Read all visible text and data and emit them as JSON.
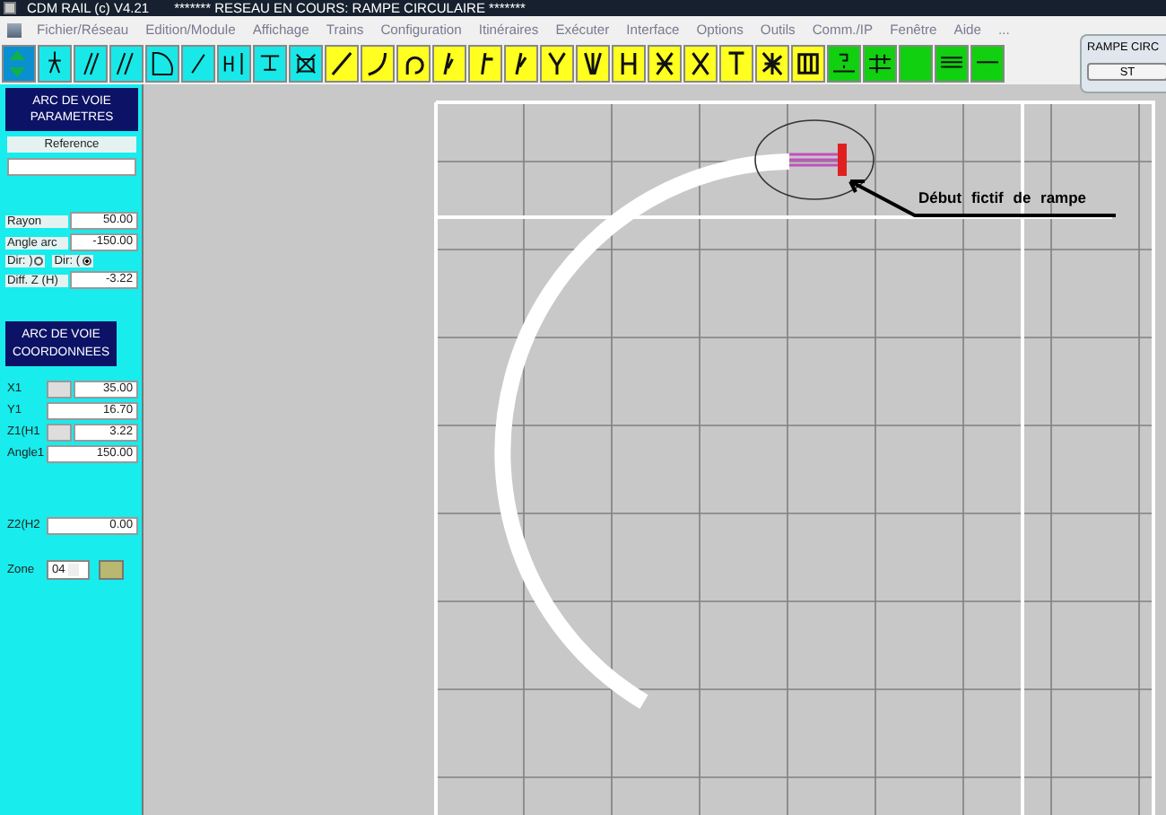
{
  "window": {
    "title": "CDM RAIL (c) V4.21",
    "subtitle": "******* RESEAU EN COURS: RAMPE CIRCULAIRE *******"
  },
  "menu": [
    {
      "label": "Fichier/Réseau"
    },
    {
      "label": "Edition/Module"
    },
    {
      "label": "Affichage"
    },
    {
      "label": "Trains"
    },
    {
      "label": "Configuration"
    },
    {
      "label": "Itinéraires"
    },
    {
      "label": "Exécuter"
    },
    {
      "label": "Interface"
    },
    {
      "label": "Options"
    },
    {
      "label": "Outils"
    },
    {
      "label": "Comm./IP"
    },
    {
      "label": "Fenêtre"
    },
    {
      "label": "Aide"
    },
    {
      "label": "..."
    }
  ],
  "toolbar": [
    {
      "kind": "nav"
    },
    {
      "kind": "tool"
    },
    {
      "kind": "tool"
    },
    {
      "kind": "tool"
    },
    {
      "kind": "tool"
    },
    {
      "kind": "tool"
    },
    {
      "kind": "tool"
    },
    {
      "kind": "tool"
    },
    {
      "kind": "tool"
    },
    {
      "kind": "track"
    },
    {
      "kind": "track"
    },
    {
      "kind": "track"
    },
    {
      "kind": "track"
    },
    {
      "kind": "track"
    },
    {
      "kind": "track"
    },
    {
      "kind": "track"
    },
    {
      "kind": "track"
    },
    {
      "kind": "track"
    },
    {
      "kind": "track"
    },
    {
      "kind": "track"
    },
    {
      "kind": "track"
    },
    {
      "kind": "track"
    },
    {
      "kind": "track"
    },
    {
      "kind": "signal"
    },
    {
      "kind": "signal"
    },
    {
      "kind": "signal"
    },
    {
      "kind": "signal"
    },
    {
      "kind": "signal"
    }
  ],
  "params": {
    "heading": [
      "ARC DE VOIE",
      "PARAMETRES"
    ],
    "reference_label": "Reference",
    "rows": [
      {
        "kind": "field",
        "label": "Rayon",
        "value": "50.00"
      },
      {
        "kind": "field",
        "label": "Angle arc",
        "value": "-150.00"
      },
      {
        "kind": "radios",
        "options": [
          {
            "label": "Dir: )",
            "selected": false
          },
          {
            "label": "Dir: (",
            "selected": true
          }
        ]
      },
      {
        "kind": "field",
        "label": "Diff. Z (H)",
        "value": "-3.22"
      }
    ]
  },
  "coords": {
    "heading": [
      "ARC DE VOIE",
      "COORDONNEES"
    ],
    "groups": [
      [
        {
          "kind": "split",
          "label": "X1",
          "value": "35.00"
        },
        {
          "kind": "field",
          "label": "Y1",
          "value": "16.70"
        },
        {
          "kind": "split",
          "label": "Z1(H1",
          "value": "3.22"
        },
        {
          "kind": "field",
          "label": "Angle1",
          "value": "150.00"
        }
      ],
      [
        {
          "kind": "field",
          "label": "Z2(H2",
          "value": "0.00"
        }
      ],
      [
        {
          "kind": "select",
          "label": "Zone",
          "value": "04"
        }
      ]
    ]
  },
  "canvas": {
    "annotation": "Début fictif de rampe"
  },
  "float_window": {
    "title": "RAMPE CIRC",
    "button": "ST"
  }
}
